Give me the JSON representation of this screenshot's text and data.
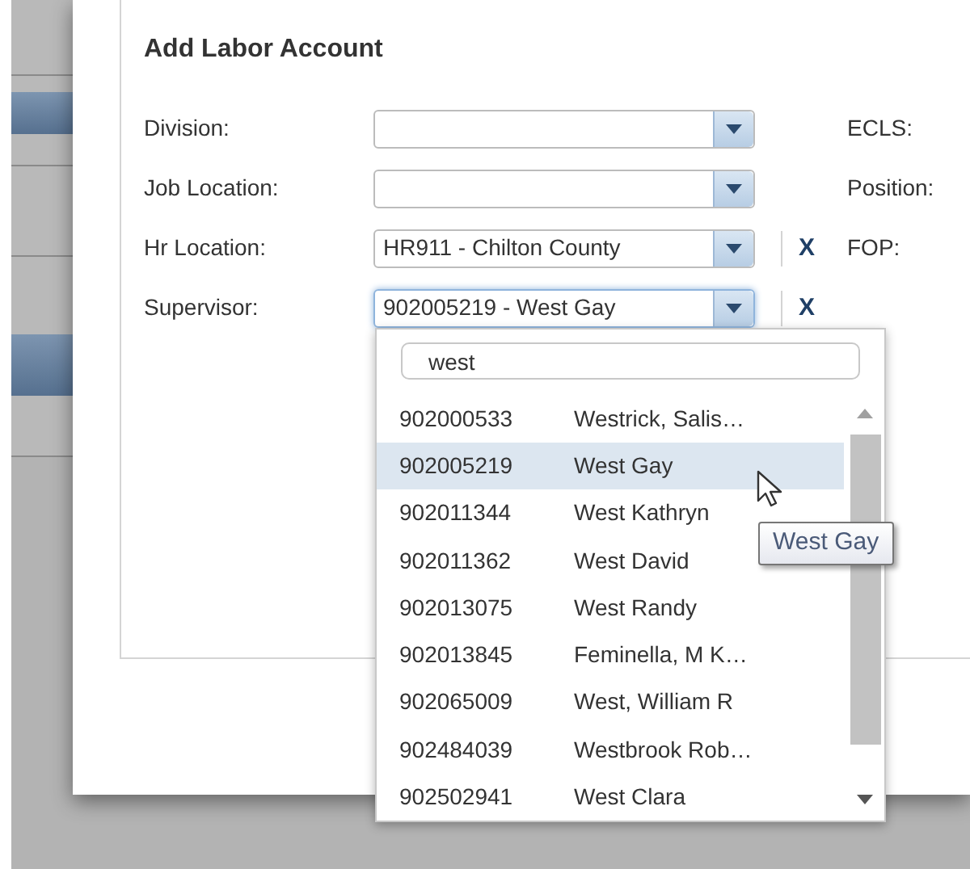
{
  "dialog": {
    "title": "Add Labor Account"
  },
  "fields": [
    {
      "label": "Division:",
      "focused": false,
      "side_label": "ECLS:"
    },
    {
      "label": "Job Location:",
      "focused": false,
      "side_label": "Position:"
    },
    {
      "label": "Hr Location:",
      "value": "HR911 - Chilton County",
      "focused": false,
      "clear": "X",
      "side_label": "FOP:"
    },
    {
      "label": "Supervisor:",
      "value": "902005219 - West Gay",
      "focused": true,
      "clear": "X"
    }
  ],
  "dropdown": {
    "search": "west",
    "rows": [
      {
        "id": "902000533",
        "name": "Westrick, Salis…",
        "selected": false
      },
      {
        "id": "902005219",
        "name": "West Gay",
        "selected": true
      },
      {
        "id": "902011344",
        "name": "West Kathryn",
        "selected": false
      },
      {
        "id": "902011362",
        "name": "West David",
        "selected": false
      },
      {
        "id": "902013075",
        "name": "West Randy",
        "selected": false
      },
      {
        "id": "902013845",
        "name": "Feminella, M K…",
        "selected": false
      },
      {
        "id": "902065009",
        "name": "West, William R",
        "selected": false
      },
      {
        "id": "902484039",
        "name": "Westbrook Rob…",
        "selected": false
      },
      {
        "id": "902502941",
        "name": "West Clara",
        "selected": false
      }
    ]
  },
  "tooltip": {
    "text": "West Gay"
  }
}
